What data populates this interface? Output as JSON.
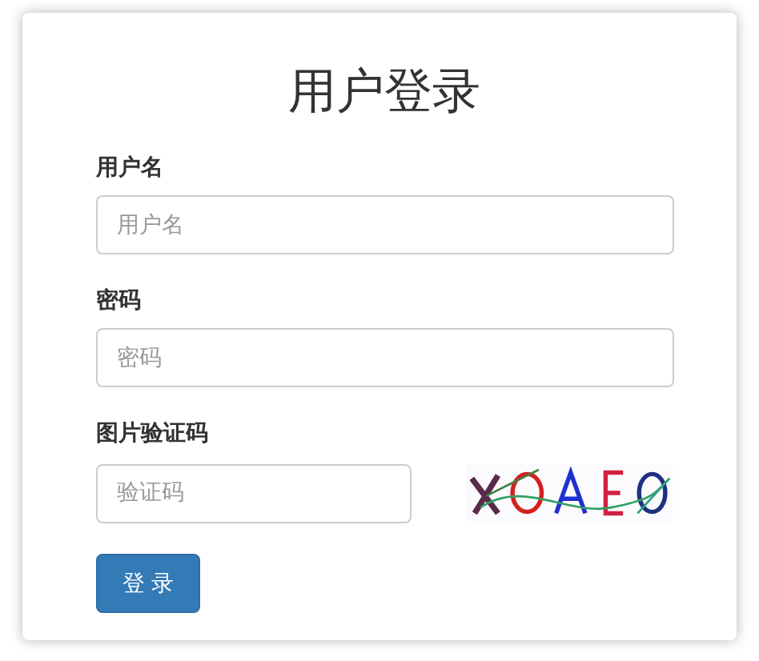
{
  "title": "用户登录",
  "fields": [
    {
      "label": "用户名",
      "placeholder": "用户名",
      "kind": "text"
    },
    {
      "label": "密码",
      "placeholder": "密码",
      "kind": "password"
    },
    {
      "label": "图片验证码",
      "placeholder": "验证码",
      "kind": "captcha"
    }
  ],
  "submit": "登 录"
}
